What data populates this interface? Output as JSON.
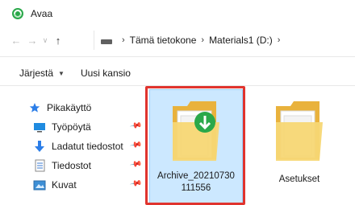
{
  "window": {
    "title": "Avaa"
  },
  "navigation": {
    "breadcrumbs": [
      "Tämä tietokone",
      "Materials1 (D:)"
    ]
  },
  "toolbar": {
    "organize_label": "Järjestä",
    "new_folder_label": "Uusi kansio"
  },
  "sidebar": {
    "items": [
      {
        "label": "Pikakäyttö",
        "icon": "star-icon",
        "pinned": false
      },
      {
        "label": "Työpöytä",
        "icon": "desktop-icon",
        "pinned": true
      },
      {
        "label": "Ladatut tiedostot",
        "icon": "download-icon",
        "pinned": true
      },
      {
        "label": "Tiedostot",
        "icon": "document-icon",
        "pinned": true
      },
      {
        "label": "Kuvat",
        "icon": "pictures-icon",
        "pinned": true
      }
    ]
  },
  "files": [
    {
      "name": "Archive_20210730 111556",
      "type": "archive-folder",
      "selected": true,
      "highlighted": true
    },
    {
      "name": "Asetukset",
      "type": "folder",
      "selected": false
    }
  ],
  "colors": {
    "selection": "#cce8ff",
    "highlight": "#e0342e",
    "folder": "#f3c857",
    "archive_badge": "#2aa84a"
  }
}
